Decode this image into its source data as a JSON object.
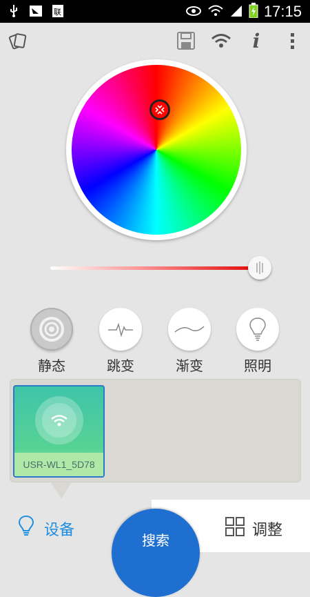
{
  "status_bar": {
    "time": "17:15",
    "icons": [
      "usb-icon",
      "notification-icon",
      "sim-icon",
      "eye-icon",
      "wifi-icon",
      "signal-icon",
      "battery-icon"
    ]
  },
  "toolbar": {
    "icons": [
      "cards-icon",
      "save-icon",
      "wifi-icon",
      "info-icon",
      "overflow-menu-icon"
    ],
    "info_glyph": "i"
  },
  "color_picker": {
    "selected_color": "#ff0000"
  },
  "brightness_slider": {
    "level_percent": 92
  },
  "modes": [
    {
      "label": "静态",
      "icon": "static-icon",
      "active": true
    },
    {
      "label": "跳变",
      "icon": "pulse-icon",
      "active": false
    },
    {
      "label": "渐变",
      "icon": "wave-icon",
      "active": false
    },
    {
      "label": "照明",
      "icon": "bulb-icon",
      "active": false
    }
  ],
  "devices": [
    {
      "name": "USR-WL1_5D78"
    }
  ],
  "bottom_nav": {
    "devices_label": "设备",
    "search_label": "搜索",
    "adjust_label": "调整"
  },
  "colors": {
    "accent": "#1e6fd0",
    "device_card": "#3ec4a9"
  }
}
